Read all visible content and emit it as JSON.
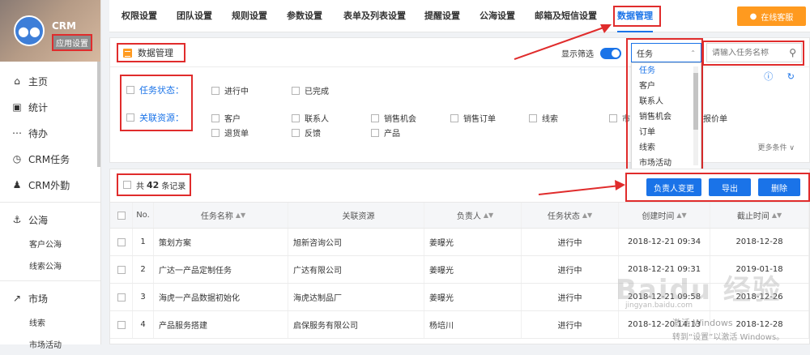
{
  "sidebar": {
    "brand_name": "CRM",
    "brand_tag": "应用设置",
    "items": [
      {
        "label": "主页",
        "icon": "home-icon"
      },
      {
        "label": "统计",
        "icon": "chart-icon"
      },
      {
        "label": "待办",
        "icon": "chat-icon"
      },
      {
        "label": "CRM任务",
        "icon": "clock-icon"
      },
      {
        "label": "CRM外勤",
        "icon": "person-icon"
      }
    ],
    "sea": {
      "label": "公海",
      "subs": [
        "客户公海",
        "线索公海"
      ]
    },
    "market": {
      "label": "市场",
      "subs": [
        "线索",
        "市场活动"
      ]
    }
  },
  "tabs": [
    "权限设置",
    "团队设置",
    "规则设置",
    "参数设置",
    "表单及列表设置",
    "提醒设置",
    "公海设置",
    "邮箱及短信设置",
    "数据管理"
  ],
  "active_tab": "数据管理",
  "online_service": "在线客服",
  "panel": {
    "title": "数据管理",
    "show_filter": "显示筛选",
    "select_value": "任务",
    "search_placeholder": "请输入任务名称",
    "dropdown": [
      "任务",
      "客户",
      "联系人",
      "销售机会",
      "订单",
      "线索",
      "市场活动"
    ],
    "status_label": "任务状态：",
    "status_opts": [
      "进行中",
      "已完成"
    ],
    "resource_label": "关联资源：",
    "resource_opts_row1": [
      "客户",
      "联系人",
      "销售机会",
      "销售订单",
      "线索",
      "市",
      "报价单"
    ],
    "resource_opts_row2": [
      "退货单",
      "反馈",
      "产品"
    ],
    "more_conditions": "更多条件 ∨"
  },
  "list": {
    "total_prefix": "共",
    "total_count": "42",
    "total_suffix": "条记录",
    "buttons": [
      "负责人变更",
      "导出",
      "删除"
    ],
    "headers": [
      "No.",
      "任务名称",
      "关联资源",
      "负责人",
      "任务状态",
      "创建时间",
      "截止时间"
    ],
    "rows": [
      {
        "no": "1",
        "name": "策划方案",
        "resource": "旭新咨询公司",
        "owner": "姜曝光",
        "status": "进行中",
        "created": "2018-12-21 09:34",
        "deadline": "2018-12-28"
      },
      {
        "no": "2",
        "name": "广达一产品定制任务",
        "resource": "广达有限公司",
        "owner": "姜曝光",
        "status": "进行中",
        "created": "2018-12-21 09:31",
        "deadline": "2019-01-18"
      },
      {
        "no": "3",
        "name": "海虎一产品数据初始化",
        "resource": "海虎达制品厂",
        "owner": "姜曝光",
        "status": "进行中",
        "created": "2018-12-21 09:58",
        "deadline": "2018-12-26"
      },
      {
        "no": "4",
        "name": "产品服务搭建",
        "resource": "启保服务有限公司",
        "owner": "杨培川",
        "status": "进行中",
        "created": "2018-12-20 14:13",
        "deadline": "2018-12-28"
      }
    ]
  },
  "watermark": {
    "logo": "Baidu 经验",
    "url": "jingyan.baidu.com",
    "win_title": "激活 Windows",
    "win_sub": "转到“设置”以激活 Windows。"
  },
  "colors": {
    "accent": "#1a73e8",
    "orange": "#ff9a1f",
    "highlight": "#e02c2c"
  }
}
